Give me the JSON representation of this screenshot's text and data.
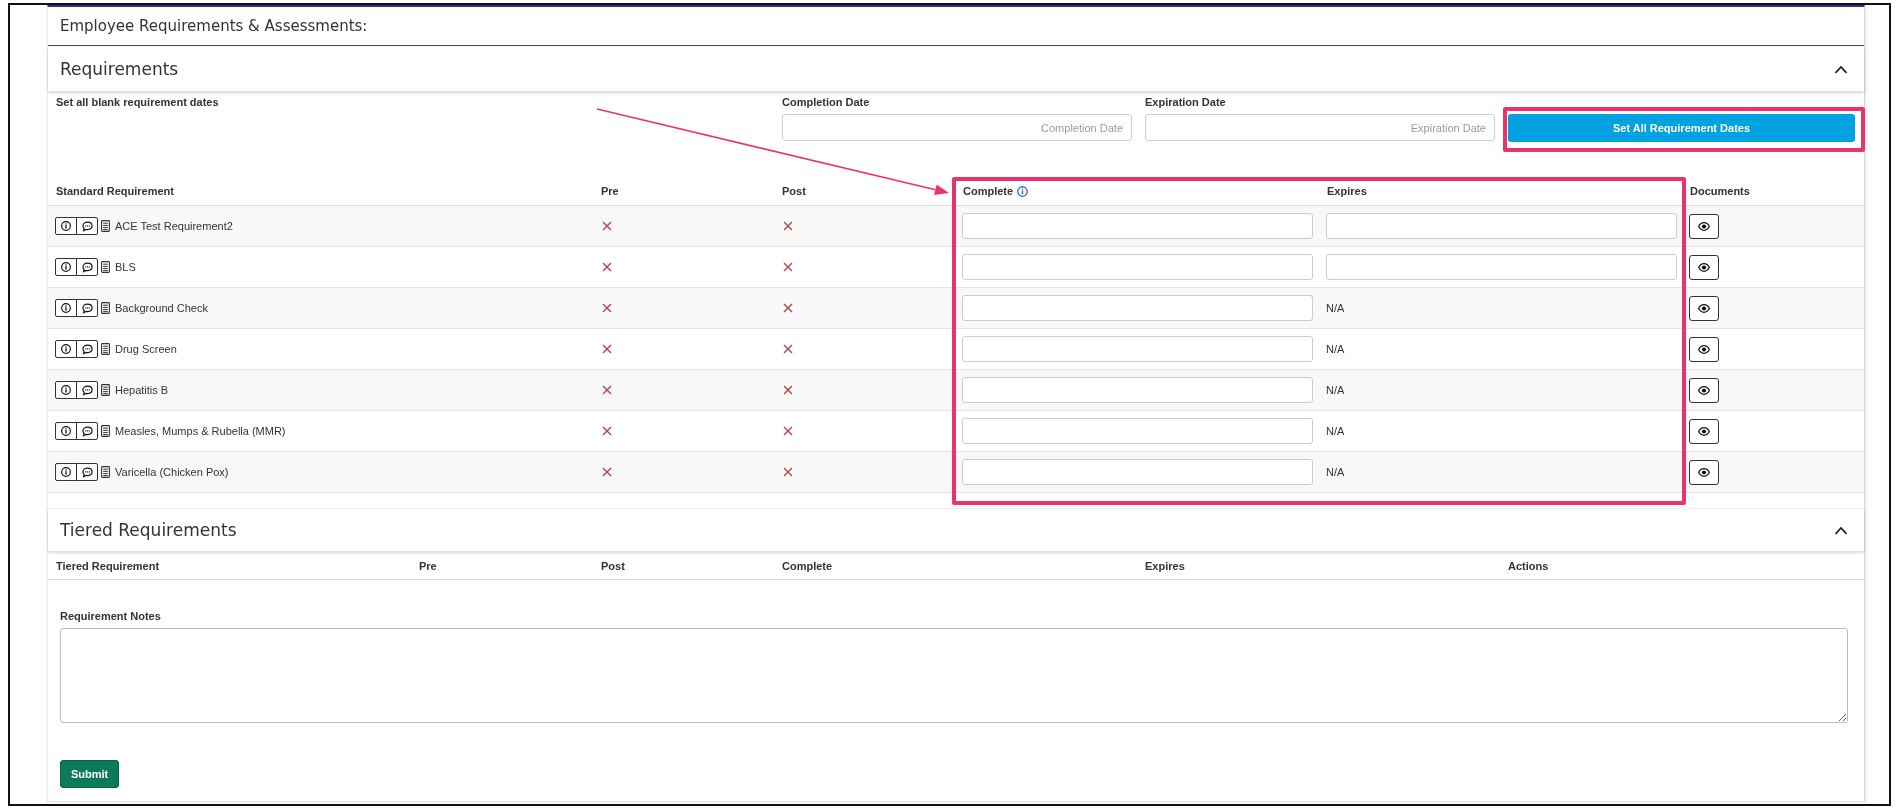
{
  "page_title": "Employee Requirements & Assessments:",
  "requirements": {
    "title": "Requirements",
    "expanded": true,
    "bulk_dates": {
      "label": "Set all blank requirement dates",
      "completion": {
        "label": "Completion Date",
        "placeholder": "Completion Date"
      },
      "expiration": {
        "label": "Expiration Date",
        "placeholder": "Expiration Date"
      },
      "button": "Set All Requirement Dates"
    },
    "table": {
      "columns": [
        {
          "label": "Standard Requirement",
          "info": false
        },
        {
          "label": "Pre",
          "info": false
        },
        {
          "label": "Post",
          "info": false
        },
        {
          "label": "Complete",
          "info": true
        },
        {
          "label": "Expires",
          "info": false
        },
        {
          "label": "Documents",
          "info": false
        }
      ],
      "rows": [
        {
          "name": "ACE Test Requirement2",
          "pre_met": false,
          "post_met": false,
          "expires": {
            "kind": "field"
          }
        },
        {
          "name": "BLS",
          "pre_met": false,
          "post_met": false,
          "expires": {
            "kind": "field"
          }
        },
        {
          "name": "Background Check",
          "pre_met": false,
          "post_met": false,
          "expires": {
            "kind": "text",
            "text": "N/A"
          }
        },
        {
          "name": "Drug Screen",
          "pre_met": false,
          "post_met": false,
          "expires": {
            "kind": "text",
            "text": "N/A"
          }
        },
        {
          "name": "Hepatitis B",
          "pre_met": false,
          "post_met": false,
          "expires": {
            "kind": "text",
            "text": "N/A"
          }
        },
        {
          "name": "Measles, Mumps & Rubella (MMR)",
          "pre_met": false,
          "post_met": false,
          "expires": {
            "kind": "text",
            "text": "N/A"
          }
        },
        {
          "name": "Varicella (Chicken Pox)",
          "pre_met": false,
          "post_met": false,
          "expires": {
            "kind": "text",
            "text": "N/A"
          }
        }
      ]
    }
  },
  "tiered_requirements": {
    "title": "Tiered Requirements",
    "expanded": true,
    "table": {
      "columns": [
        "Tiered Requirement",
        "Pre",
        "Post",
        "Complete",
        "Expires",
        "Actions"
      ]
    }
  },
  "notes": {
    "label": "Requirement Notes"
  },
  "submit_button": "Submit"
}
